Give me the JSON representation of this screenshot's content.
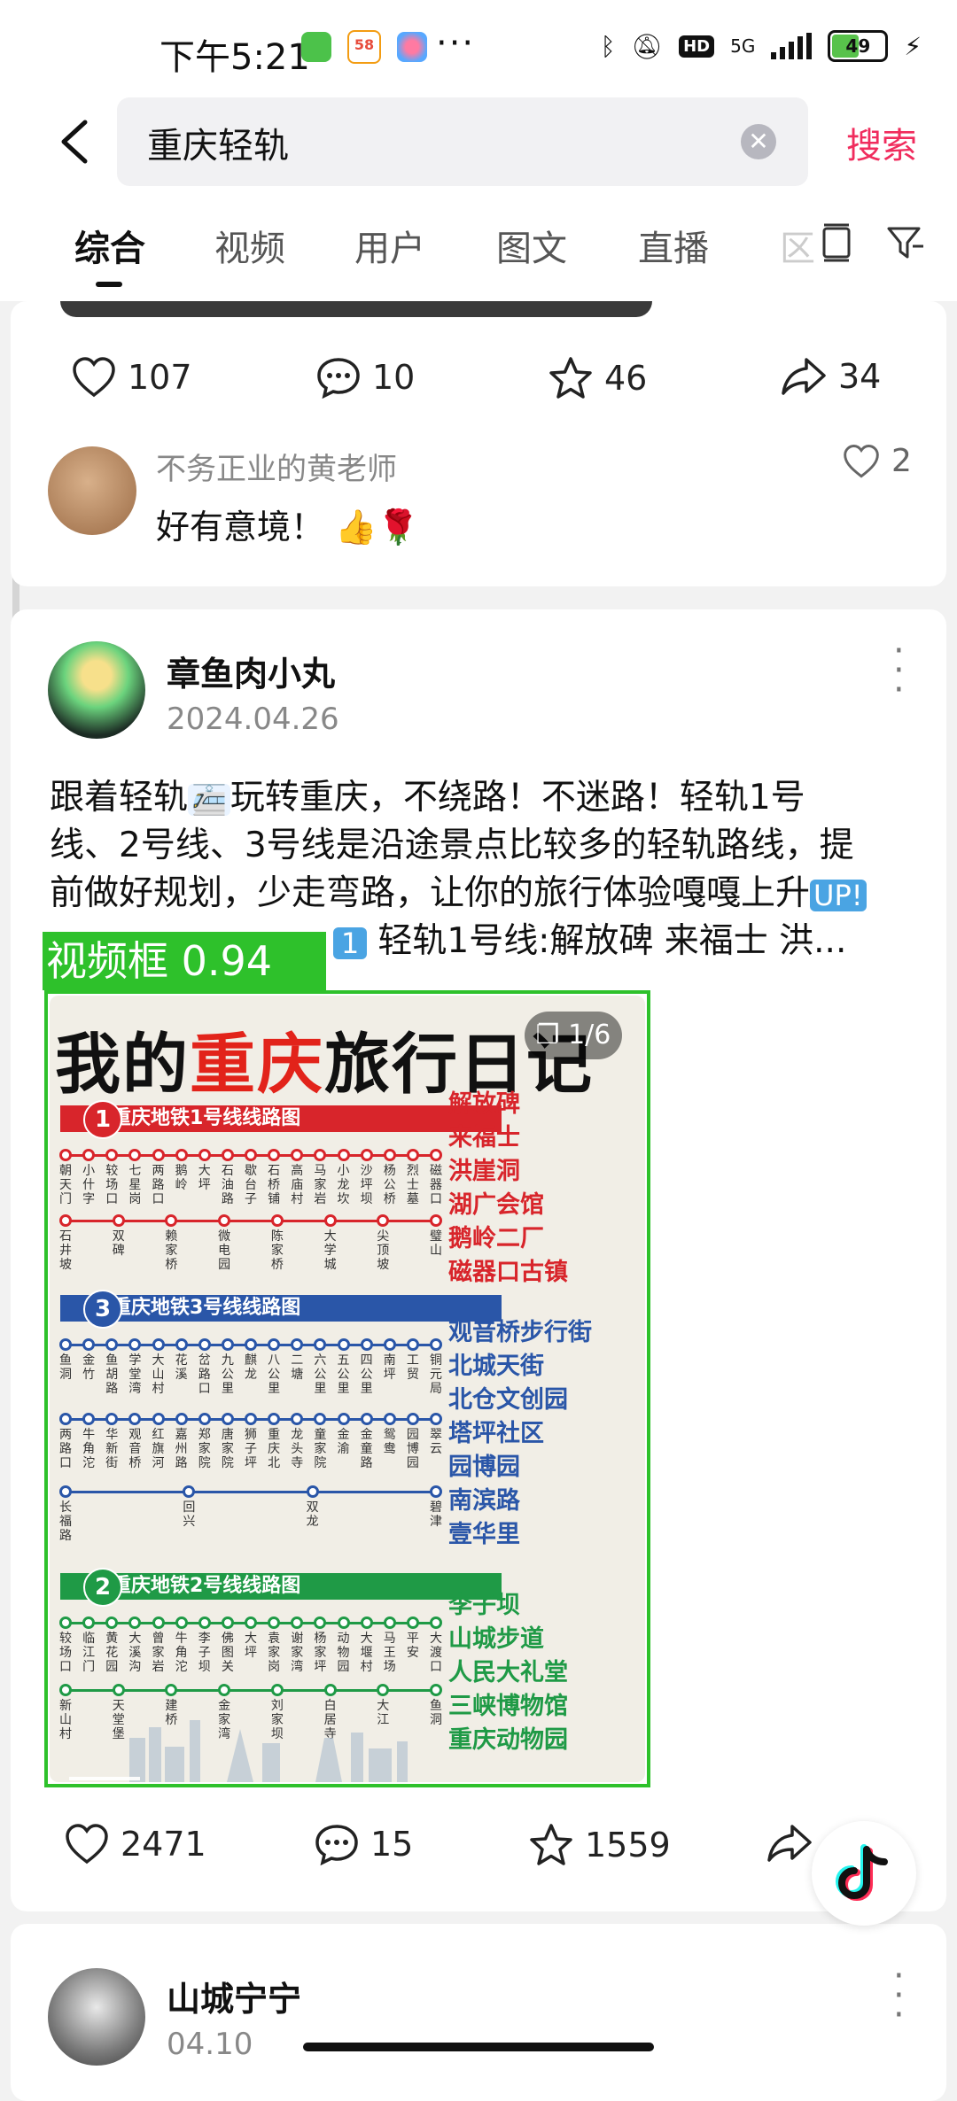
{
  "status_bar": {
    "time": "下午5:21",
    "network": "5G",
    "battery": "49",
    "badge_58": "58"
  },
  "search": {
    "query": "重庆轻轨",
    "button_label": "搜索"
  },
  "tabs": [
    {
      "label": "综合"
    },
    {
      "label": "视频"
    },
    {
      "label": "用户"
    },
    {
      "label": "图文"
    },
    {
      "label": "直播"
    },
    {
      "label": "区"
    }
  ],
  "post1": {
    "likes": "107",
    "comments": "10",
    "favorites": "46",
    "shares": "34",
    "comment": {
      "author": "不务正业的黄老师",
      "text": "好有意境！",
      "likes": "2"
    }
  },
  "post2": {
    "author": "章鱼肉小丸",
    "date": "2024.04.26",
    "text_line1": "跟着轻轨",
    "text_line1b": "玩转重庆，不绕路！不迷路！轻轨1号",
    "text_line2": "线、2号线、3号线是沿途景点比较多的轻轨路线，提",
    "text_line3": "前做好规划，少走弯路，让你的旅行体验嘎嘎上升",
    "text_line4": "轻轨1号线:解放碑 来福士 洪...",
    "emoji_up": "UP!",
    "emoji_1": "1",
    "likes": "2471",
    "comments": "15",
    "favorites": "1559"
  },
  "detection": {
    "label": "视频框 0.94"
  },
  "travel_image": {
    "title_a": "我的",
    "title_b": "重庆",
    "title_c": "旅行日记",
    "page_badge": "1/6",
    "line1": {
      "num": "1",
      "title": "重庆地铁1号线线路图",
      "row1_stations": [
        "朝天门",
        "小什字",
        "较场口",
        "七星岗",
        "两路口",
        "鹅岭",
        "大坪",
        "石油路",
        "歇台子",
        "石桥铺",
        "高庙村",
        "马家岩",
        "小龙坎",
        "沙坪坝",
        "杨公桥",
        "烈士墓",
        "磁器口"
      ],
      "row2_stations": [
        "石井坡",
        "双碑",
        "赖家桥",
        "微电园",
        "陈家桥",
        "大学城",
        "尖顶坡",
        "璧山"
      ]
    },
    "line3": {
      "num": "3",
      "title": "重庆地铁3号线线路图",
      "row1_stations": [
        "鱼洞",
        "金竹",
        "鱼胡路",
        "学堂湾",
        "大山村",
        "花溪",
        "岔路口",
        "九公里",
        "麒龙",
        "八公里",
        "二塘",
        "六公里",
        "五公里",
        "四公里",
        "南坪",
        "工贸",
        "铜元局"
      ],
      "row2_stations": [
        "两路口",
        "牛角沱",
        "华新街",
        "观音桥",
        "红旗河沟",
        "嘉州路",
        "郑家院子",
        "唐家院子",
        "狮子坪",
        "重庆北站",
        "龙头寺",
        "童家院子",
        "金渝",
        "金童路",
        "鸳鸯",
        "园博园",
        "翠云"
      ],
      "row3_stations": [
        "长福路",
        "回兴",
        "双龙",
        "碧津"
      ]
    },
    "line2": {
      "num": "2",
      "title": "重庆地铁2号线线路图",
      "row1_stations": [
        "较场口",
        "临江门",
        "黄花园",
        "大溪沟",
        "曾家岩",
        "牛角沱",
        "李子坝",
        "佛图关",
        "大坪",
        "袁家岗",
        "谢家湾",
        "杨家坪",
        "动物园",
        "大堰村",
        "马王场",
        "平安",
        "大渡口"
      ],
      "row2_stations": [
        "新山村",
        "天堂堡",
        "建桥",
        "金家湾",
        "刘家坝",
        "白居寺",
        "大江",
        "鱼洞"
      ]
    },
    "spots_red": [
      "解放碑",
      "来福士",
      "洪崖洞",
      "湖广会馆",
      "鹅岭二厂",
      "磁器口古镇"
    ],
    "spots_blue": [
      "观音桥步行街",
      "北城天街",
      "北仓文创园",
      "塔坪社区",
      "园博园",
      "南滨路",
      "壹华里"
    ],
    "spots_green": [
      "李子坝",
      "山城步道",
      "人民大礼堂",
      "三峡博物馆",
      "重庆动物园"
    ]
  },
  "post3": {
    "author": "山城宁宁",
    "date": "04.10"
  },
  "colors": {
    "accent": "#f02c5d",
    "line1": "#d8252b",
    "line3": "#2a56a8",
    "line2": "#1f9a46",
    "detection": "#2ec12b"
  }
}
